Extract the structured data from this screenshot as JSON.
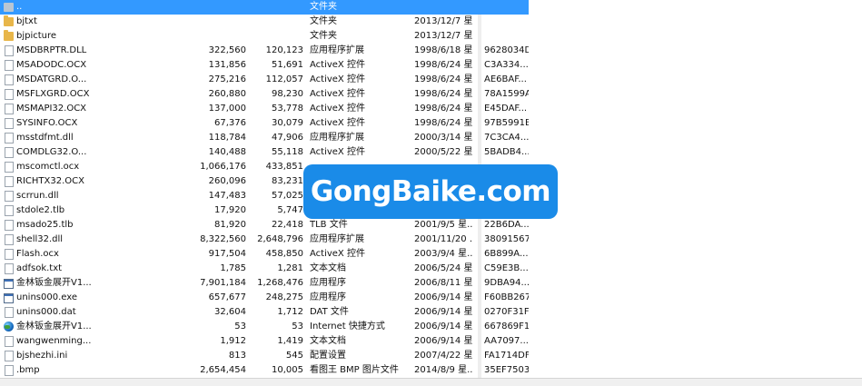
{
  "files": [
    {
      "icon": "up-folder-icon",
      "name": "..",
      "size": "",
      "packed": "",
      "type": "文件夹",
      "date": "",
      "crc": "",
      "selected": true
    },
    {
      "icon": "folder-icon",
      "name": "bjtxt",
      "size": "",
      "packed": "",
      "type": "文件夹",
      "date": "2013/12/7 星...",
      "crc": ""
    },
    {
      "icon": "folder-icon",
      "name": "bjpicture",
      "size": "",
      "packed": "",
      "type": "文件夹",
      "date": "2013/12/7 星...",
      "crc": ""
    },
    {
      "icon": "document-icon",
      "name": "MSDBRPTR.DLL",
      "size": "322,560",
      "packed": "120,123",
      "type": "应用程序扩展",
      "date": "1998/6/18 星...",
      "crc": "9628034D"
    },
    {
      "icon": "document-icon",
      "name": "MSADODC.OCX",
      "size": "131,856",
      "packed": "51,691",
      "type": "ActiveX 控件",
      "date": "1998/6/24 星...",
      "crc": "C3A334..."
    },
    {
      "icon": "document-icon",
      "name": "MSDATGRD.O...",
      "size": "275,216",
      "packed": "112,057",
      "type": "ActiveX 控件",
      "date": "1998/6/24 星...",
      "crc": "AE6BAF..."
    },
    {
      "icon": "document-icon",
      "name": "MSFLXGRD.OCX",
      "size": "260,880",
      "packed": "98,230",
      "type": "ActiveX 控件",
      "date": "1998/6/24 星...",
      "crc": "78A1599A"
    },
    {
      "icon": "document-icon",
      "name": "MSMAPI32.OCX",
      "size": "137,000",
      "packed": "53,778",
      "type": "ActiveX 控件",
      "date": "1998/6/24 星...",
      "crc": "E45DAF..."
    },
    {
      "icon": "document-icon",
      "name": "SYSINFO.OCX",
      "size": "67,376",
      "packed": "30,079",
      "type": "ActiveX 控件",
      "date": "1998/6/24 星...",
      "crc": "97B5991B"
    },
    {
      "icon": "document-icon",
      "name": "msstdfmt.dll",
      "size": "118,784",
      "packed": "47,906",
      "type": "应用程序扩展",
      "date": "2000/3/14 星...",
      "crc": "7C3CA4..."
    },
    {
      "icon": "document-icon",
      "name": "COMDLG32.O...",
      "size": "140,488",
      "packed": "55,118",
      "type": "ActiveX 控件",
      "date": "2000/5/22 星...",
      "crc": "5BADB4..."
    },
    {
      "icon": "document-icon",
      "name": "mscomctl.ocx",
      "size": "1,066,176",
      "packed": "433,851",
      "type": "",
      "date": "",
      "crc": ""
    },
    {
      "icon": "document-icon",
      "name": "RICHTX32.OCX",
      "size": "260,096",
      "packed": "83,231",
      "type": "",
      "date": "",
      "crc": ""
    },
    {
      "icon": "document-icon",
      "name": "scrrun.dll",
      "size": "147,483",
      "packed": "57,025",
      "type": "",
      "date": "",
      "crc": ""
    },
    {
      "icon": "document-icon",
      "name": "stdole2.tlb",
      "size": "17,920",
      "packed": "5,747",
      "type": "",
      "date": "",
      "crc": ""
    },
    {
      "icon": "document-icon",
      "name": "msado25.tlb",
      "size": "81,920",
      "packed": "22,418",
      "type": "TLB 文件",
      "date": "2001/9/5 星...",
      "crc": "22B6DA..."
    },
    {
      "icon": "document-icon",
      "name": "shell32.dll",
      "size": "8,322,560",
      "packed": "2,648,796",
      "type": "应用程序扩展",
      "date": "2001/11/20 ...",
      "crc": "38091567"
    },
    {
      "icon": "document-icon",
      "name": "Flash.ocx",
      "size": "917,504",
      "packed": "458,850",
      "type": "ActiveX 控件",
      "date": "2003/9/4 星...",
      "crc": "6B899A..."
    },
    {
      "icon": "document-icon",
      "name": "adfsok.txt",
      "size": "1,785",
      "packed": "1,281",
      "type": "文本文档",
      "date": "2006/5/24 星...",
      "crc": "C59E3B..."
    },
    {
      "icon": "application-icon",
      "name": "金林钣金展开V1...",
      "size": "7,901,184",
      "packed": "1,268,476",
      "type": "应用程序",
      "date": "2006/8/11 星...",
      "crc": "9DBA94..."
    },
    {
      "icon": "application-icon",
      "name": "unins000.exe",
      "size": "657,677",
      "packed": "248,275",
      "type": "应用程序",
      "date": "2006/9/14 星...",
      "crc": "F60BB267"
    },
    {
      "icon": "document-icon",
      "name": "unins000.dat",
      "size": "32,604",
      "packed": "1,712",
      "type": "DAT 文件",
      "date": "2006/9/14 星...",
      "crc": "0270F31F"
    },
    {
      "icon": "globe-icon",
      "name": "金林钣金展开V1...",
      "size": "53",
      "packed": "53",
      "type": "Internet 快捷方式",
      "date": "2006/9/14 星...",
      "crc": "667869F1"
    },
    {
      "icon": "document-icon",
      "name": "wangwenming...",
      "size": "1,912",
      "packed": "1,419",
      "type": "文本文档",
      "date": "2006/9/14 星...",
      "crc": "AA7097..."
    },
    {
      "icon": "document-icon",
      "name": "bjshezhi.ini",
      "size": "813",
      "packed": "545",
      "type": "配置设置",
      "date": "2007/4/22 星...",
      "crc": "FA1714DF"
    },
    {
      "icon": "document-icon",
      "name": ".bmp",
      "size": "2,654,454",
      "packed": "10,005",
      "type": "看图王 BMP 图片文件",
      "date": "2014/8/9 星...",
      "crc": "35EF7503"
    }
  ],
  "watermark": "GongBaike.com"
}
